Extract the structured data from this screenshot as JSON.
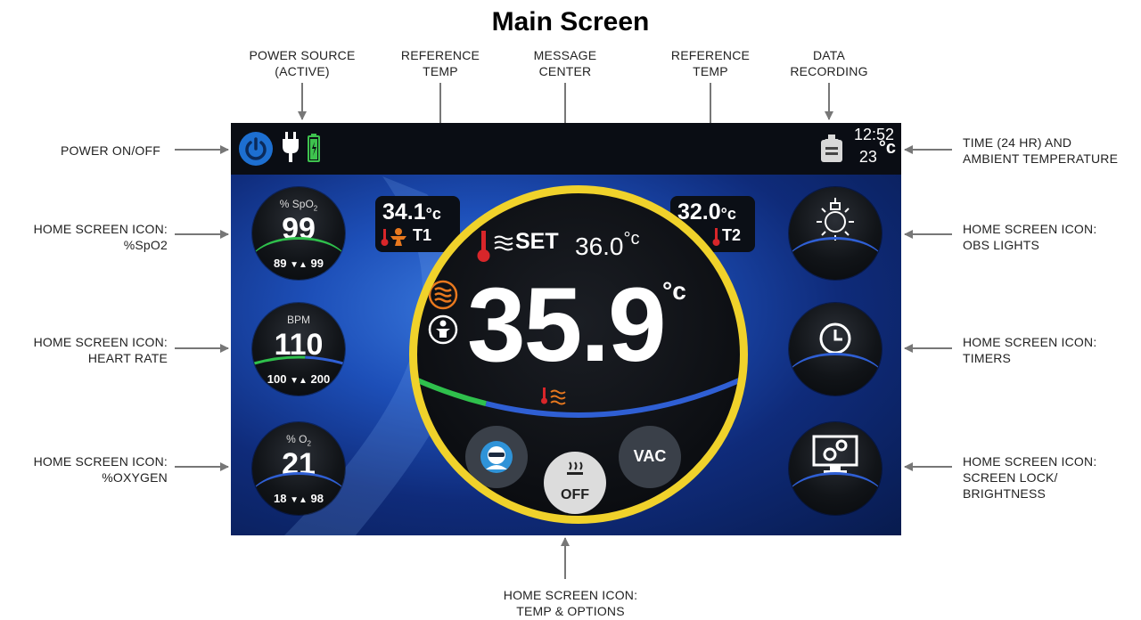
{
  "title": "Main Screen",
  "annotations": {
    "power_source": [
      "POWER SOURCE",
      "(ACTIVE)"
    ],
    "ref_temp_left": [
      "REFERENCE",
      "TEMP"
    ],
    "message_center": [
      "MESSAGE",
      "CENTER"
    ],
    "ref_temp_right": [
      "REFERENCE",
      "TEMP"
    ],
    "data_recording": [
      "DATA",
      "RECORDING"
    ],
    "power_onoff": "POWER ON/OFF",
    "time_ambient": [
      "TIME  (24 HR) AND",
      "AMBIENT  TEMPERATURE"
    ],
    "spo2": [
      "HOME SCREEN ICON:",
      "%SpO2"
    ],
    "heart_rate": [
      "HOME SCREEN ICON:",
      "HEART RATE"
    ],
    "oxygen": [
      "HOME SCREEN ICON:",
      "%OXYGEN"
    ],
    "obs_lights": [
      "HOME SCREEN ICON:",
      "OBS LIGHTS"
    ],
    "timers": [
      "HOME SCREEN ICON:",
      "TIMERS"
    ],
    "screen_lock": [
      "HOME SCREEN ICON:",
      "SCREEN LOCK/",
      "BRIGHTNESS"
    ],
    "temp_options": [
      "HOME SCREEN ICON:",
      "TEMP & OPTIONS"
    ]
  },
  "screen": {
    "time": "12:52",
    "ambient_temp": "23",
    "ambient_unit": "°c",
    "spo2": {
      "label": "% SpO",
      "label_sub": "2",
      "value": "99",
      "low": "89",
      "high": "99"
    },
    "heart_rate": {
      "label": "BPM",
      "value": "110",
      "low": "100",
      "high": "200"
    },
    "oxygen": {
      "label": "% O",
      "label_sub": "2",
      "value": "21",
      "low": "18",
      "high": "98"
    },
    "ref_left": {
      "value": "34.1",
      "unit": "°c",
      "tag": "T1"
    },
    "ref_right": {
      "value": "32.0",
      "unit": "°c",
      "tag": "T2"
    },
    "set_label": "SET",
    "set_value": "36.0",
    "set_unit": "°c",
    "main_temp": "35.9",
    "main_unit": "°c",
    "vac_label": "VAC",
    "off_label": "OFF"
  },
  "colors": {
    "accent_yellow": "#f0d22b",
    "arc_blue": "#2f5fd4",
    "arc_green": "#2fc04c",
    "heat_orange": "#e8781e",
    "thermo_red": "#d8262a",
    "power_blue": "#1d6fd1"
  }
}
